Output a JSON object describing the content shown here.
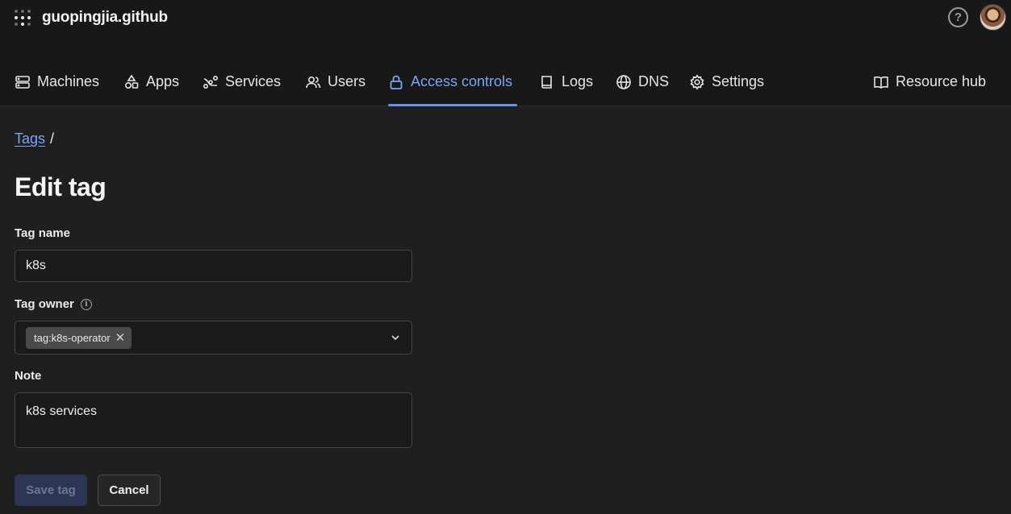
{
  "header": {
    "org_name": "guopingjia.github",
    "help_label": "?"
  },
  "nav": {
    "items": [
      {
        "label": "Machines",
        "icon": "machines-icon"
      },
      {
        "label": "Apps",
        "icon": "apps-icon"
      },
      {
        "label": "Services",
        "icon": "services-icon"
      },
      {
        "label": "Users",
        "icon": "users-icon"
      },
      {
        "label": "Access controls",
        "icon": "lock-icon",
        "active": true
      },
      {
        "label": "Logs",
        "icon": "book-icon"
      },
      {
        "label": "DNS",
        "icon": "globe-icon"
      },
      {
        "label": "Settings",
        "icon": "gear-icon"
      }
    ],
    "resource_hub": "Resource hub"
  },
  "breadcrumb": {
    "parent": "Tags",
    "separator": "/"
  },
  "form": {
    "title": "Edit tag",
    "tag_name_label": "Tag name",
    "tag_name_value": "k8s",
    "tag_owner_label": "Tag owner",
    "owners": [
      "tag:k8s-operator"
    ],
    "note_label": "Note",
    "note_value": "k8s services",
    "save_label": "Save tag",
    "cancel_label": "Cancel"
  },
  "colors": {
    "accent": "#7ea3f5",
    "background": "#1f1f1f",
    "topbar": "#181818"
  }
}
